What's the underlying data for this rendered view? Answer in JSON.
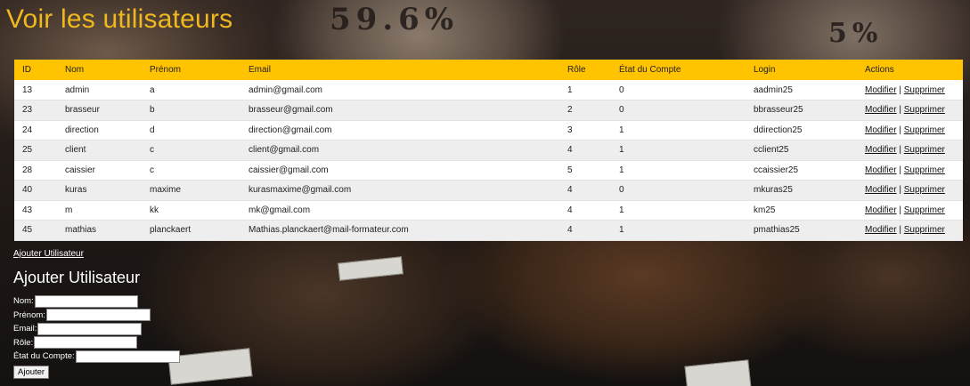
{
  "page": {
    "title": "Voir les utilisateurs",
    "add_link": "Ajouter Utilisateur",
    "form_title": "Ajouter Utilisateur",
    "accent_color": "#ffc300",
    "title_color": "#f0b81e"
  },
  "table": {
    "headers": [
      "ID",
      "Nom",
      "Prénom",
      "Email",
      "Rôle",
      "État du Compte",
      "Login",
      "Actions"
    ],
    "action_edit": "Modifier",
    "action_separator": "|",
    "action_delete": "Supprimer",
    "rows": [
      {
        "id": "13",
        "nom": "admin",
        "prenom": "a",
        "email": "admin@gmail.com",
        "role": "1",
        "etat": "0",
        "login": "aadmin25"
      },
      {
        "id": "23",
        "nom": "brasseur",
        "prenom": "b",
        "email": "brasseur@gmail.com",
        "role": "2",
        "etat": "0",
        "login": "bbrasseur25"
      },
      {
        "id": "24",
        "nom": "direction",
        "prenom": "d",
        "email": "direction@gmail.com",
        "role": "3",
        "etat": "1",
        "login": "ddirection25"
      },
      {
        "id": "25",
        "nom": "client",
        "prenom": "c",
        "email": "client@gmail.com",
        "role": "4",
        "etat": "1",
        "login": "cclient25"
      },
      {
        "id": "28",
        "nom": "caissier",
        "prenom": "c",
        "email": "caissier@gmail.com",
        "role": "5",
        "etat": "1",
        "login": "ccaissier25"
      },
      {
        "id": "40",
        "nom": "kuras",
        "prenom": "maxime",
        "email": "kurasmaxime@gmail.com",
        "role": "4",
        "etat": "0",
        "login": "mkuras25"
      },
      {
        "id": "43",
        "nom": "m",
        "prenom": "kk",
        "email": "mk@gmail.com",
        "role": "4",
        "etat": "1",
        "login": "km25"
      },
      {
        "id": "45",
        "nom": "mathias",
        "prenom": "planckaert",
        "email": "Mathias.planckaert@mail-formateur.com",
        "role": "4",
        "etat": "1",
        "login": "pmathias25"
      }
    ]
  },
  "form": {
    "fields": [
      {
        "label": "Nom:",
        "value": ""
      },
      {
        "label": "Prénom:",
        "value": ""
      },
      {
        "label": "Email:",
        "value": ""
      },
      {
        "label": "Rôle:",
        "value": ""
      },
      {
        "label": "État du Compte:",
        "value": ""
      }
    ],
    "submit_label": "Ajouter"
  }
}
